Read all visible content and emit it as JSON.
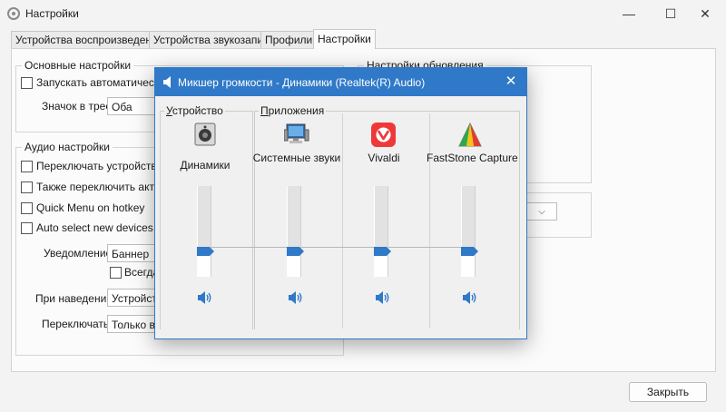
{
  "window": {
    "title": "Настройки",
    "minimize_glyph": "—",
    "maximize_glyph": "☐",
    "close_glyph": "✕"
  },
  "tabs": [
    {
      "label": "Устройства воспроизведения"
    },
    {
      "label": "Устройства звукозаписи"
    },
    {
      "label": "Профили"
    },
    {
      "label": "Настройки"
    }
  ],
  "basic": {
    "title": "Основные настройки",
    "autostart_label": "Запускать автоматически с",
    "tray_label": "Значок в трее",
    "tray_value": "Оба"
  },
  "audio": {
    "title": "Аудио настройки",
    "switch_label": "Переключать устройство с",
    "also_switch_label": "Также переключить активн",
    "quick_menu_label": "Quick Menu on hotkey",
    "auto_select_label": "Auto select new devices",
    "notify_label": "Уведомление",
    "notify_value": "Баннер",
    "always_label": "Всегда",
    "hover_label": "При наведении",
    "hover_value": "Устройств",
    "switch2_label": "Переключать",
    "switch2_value": "Только вы"
  },
  "updates": {
    "title": "Настройки обновления"
  },
  "close_button": "Закрыть",
  "mixer": {
    "title": "Микшер громкости - Динамики (Realtek(R) Audio)",
    "close_glyph": "✕",
    "device_group": "Устройство",
    "device_group_access": "У",
    "device_group_rest": "стройство",
    "apps_group": "Приложения",
    "apps_group_access": "П",
    "apps_group_rest": "риложения",
    "channels": [
      {
        "name": "Динамики",
        "icon": "speaker-device-icon",
        "level": 0.28
      },
      {
        "name": "Системные звуки",
        "icon": "system-sounds-icon",
        "level": 0.28
      },
      {
        "name": "Vivaldi",
        "icon": "vivaldi-icon",
        "level": 0.28
      },
      {
        "name": "FastStone Capture",
        "icon": "faststone-capture-icon",
        "level": 0.28
      }
    ]
  },
  "colors": {
    "accent": "#2f79c8",
    "vivaldi": "#ef3939"
  }
}
